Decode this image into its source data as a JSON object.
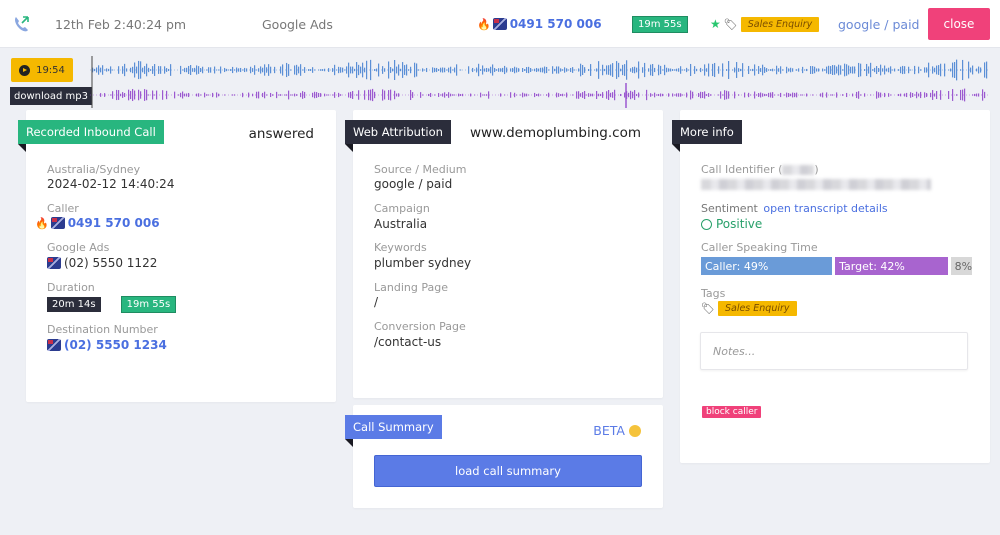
{
  "topbar": {
    "datetime": "12th Feb 2:40:24 pm",
    "source": "Google Ads",
    "caller_number": "0491 570 006",
    "duration": "19m 55s",
    "tag": "Sales Enquiry",
    "attribution": "google / paid",
    "close_label": "close"
  },
  "player": {
    "time": "19:54",
    "download_label": "download mp3"
  },
  "recorded_card": {
    "title": "Recorded Inbound Call",
    "status": "answered",
    "timezone": "Australia/Sydney",
    "datetime": "2024-02-12 14:40:24",
    "caller_label": "Caller",
    "caller_number": "0491 570 006",
    "source_label": "Google Ads",
    "source_number": "(02) 5550 1122",
    "duration_label": "Duration",
    "duration_ring": "20m 14s",
    "duration_talk": "19m 55s",
    "destination_label": "Destination Number",
    "destination_number": "(02) 5550 1234"
  },
  "web_card": {
    "title": "Web Attribution",
    "domain": "www.demoplumbing.com",
    "source_label": "Source / Medium",
    "source_value": "google / paid",
    "campaign_label": "Campaign",
    "campaign_value": "Australia",
    "keywords_label": "Keywords",
    "keywords_value": "plumber sydney",
    "landing_label": "Landing Page",
    "landing_value": "/",
    "conversion_label": "Conversion Page",
    "conversion_value": "/contact-us"
  },
  "summary_card": {
    "title": "Call Summary",
    "beta": "BETA",
    "button_label": "load call summary"
  },
  "info_card": {
    "title": "More info",
    "identifier_label": "Call Identifier (",
    "identifier_close": ")",
    "sentiment_label": "Sentiment",
    "transcript_link": "open transcript details",
    "sentiment_value": "Positive",
    "speaking_label": "Caller Speaking Time",
    "caller_pct": "Caller: 49%",
    "target_pct": "Target: 42%",
    "other_pct": "8%",
    "speaking_shares": {
      "caller": 49,
      "target": 42,
      "other": 8
    },
    "tags_label": "Tags",
    "tag": "Sales Enquiry",
    "notes_placeholder": "Notes...",
    "block_label": "block caller"
  },
  "colors": {
    "accent_blue": "#5b7be6",
    "green": "#28b67f",
    "pink": "#f0417a",
    "yellow": "#f5b800",
    "caller_bar": "#6a9bd8",
    "target_bar": "#a864cf",
    "other_bar": "#d8d8d8"
  }
}
